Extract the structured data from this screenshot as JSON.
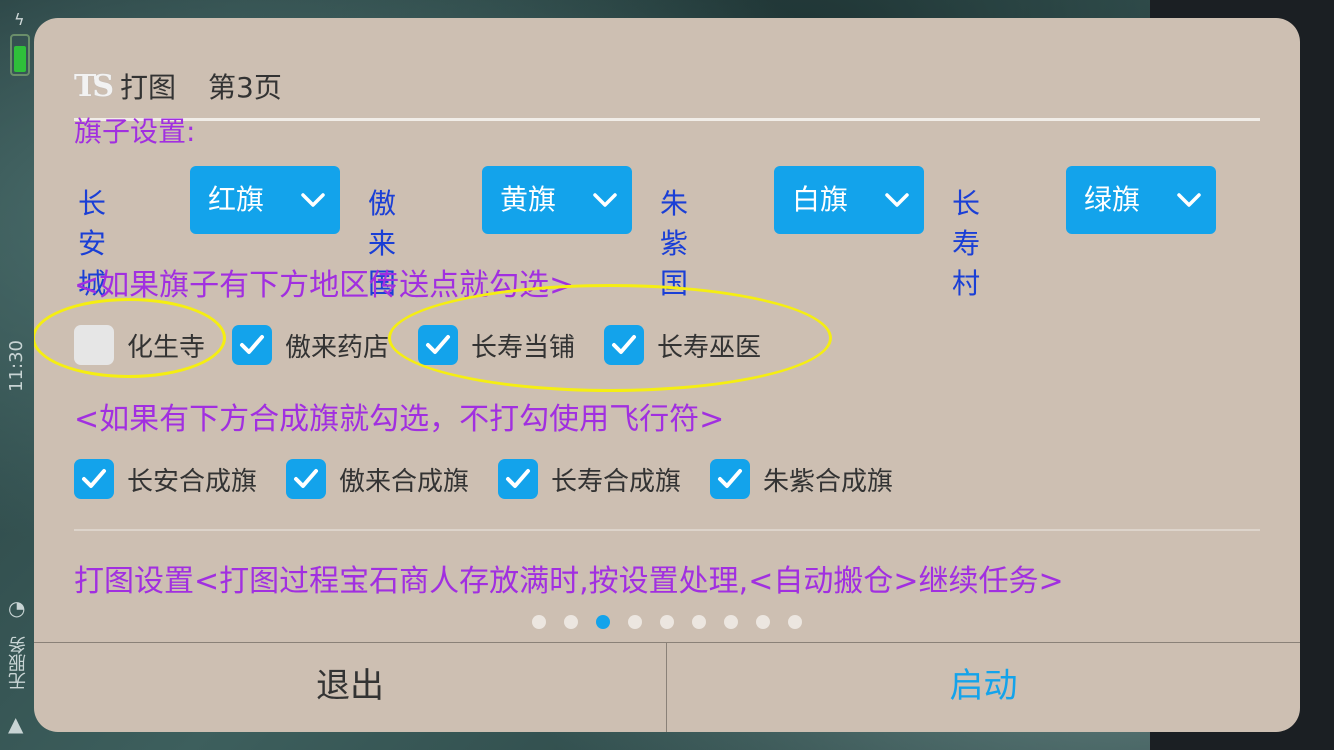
{
  "status_bar": {
    "time": "11:30",
    "carrier": "无服务"
  },
  "header": {
    "logo": "TS",
    "title": "打图",
    "page": "第3页"
  },
  "cut_off_text": "旗子设置:",
  "flags": [
    {
      "region": "长安城",
      "flag": "红旗"
    },
    {
      "region": "傲来国",
      "flag": "黄旗"
    },
    {
      "region": "朱紫国",
      "flag": "白旗"
    },
    {
      "region": "长寿村",
      "flag": "绿旗"
    }
  ],
  "teleport_section": {
    "label": "<如果旗子有下方地区传送点就勾选>",
    "items": [
      {
        "label": "化生寺",
        "checked": false
      },
      {
        "label": "傲来药店",
        "checked": true
      },
      {
        "label": "长寿当铺",
        "checked": true
      },
      {
        "label": "长寿巫医",
        "checked": true
      }
    ]
  },
  "composite_section": {
    "label": "<如果有下方合成旗就勾选，不打勾使用飞行符>",
    "items": [
      {
        "label": "长安合成旗",
        "checked": true
      },
      {
        "label": "傲来合成旗",
        "checked": true
      },
      {
        "label": "长寿合成旗",
        "checked": true
      },
      {
        "label": "朱紫合成旗",
        "checked": true
      }
    ]
  },
  "map_settings_text": "打图设置<打图过程宝石商人存放满时,按设置处理,<自动搬仓>继续任务>",
  "pagination": {
    "total": 9,
    "current": 3
  },
  "footer": {
    "exit_label": "退出",
    "start_label": "启动"
  },
  "colors": {
    "accent": "#13a3eb",
    "purple_text": "#a12fe0",
    "region_text": "#1a3fd6",
    "dialog_bg": "#cdbfb2",
    "annotation": "#f5ee12"
  },
  "icons": {
    "dropdown": "chevron-down-icon",
    "checkbox": "checkmark-icon"
  }
}
